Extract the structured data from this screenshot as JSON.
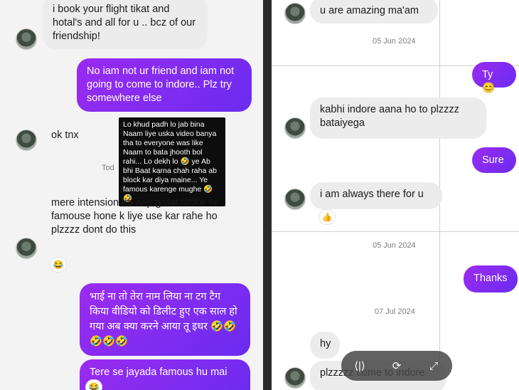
{
  "left": {
    "messages": [
      {
        "id": "m1",
        "text": "i book your flight tikat and hotal's and all for u .. bcz of our friendship!"
      },
      {
        "id": "m2",
        "text": "No iam not ur friend and iam not going to come to indore.. Plz try somewhere else"
      },
      {
        "id": "m3",
        "text": "ok tnx"
      },
      {
        "id": "m4",
        "text": "Tod"
      },
      {
        "id": "m5",
        "text": "mere intension ko aap galat tatike se famouse hone k liye use kar rahe ho plzzzz dont do this"
      },
      {
        "id": "m5r",
        "text": "😂"
      },
      {
        "id": "m6",
        "text": "भाई ना तो तेरा नाम लिया ना टग टैग किया वीडियो को डिलीट हुए एक साल हो गया अब क्या करने आया तू इधर 🤣🤣🤣🤣🤣"
      },
      {
        "id": "m7",
        "text": "Tere se jayada famous hu mai"
      },
      {
        "id": "m7r",
        "text": "😂"
      }
    ],
    "overlay": "Lo khud padh lo jab bina Naam liye uska video banya tha to everyone was like Naam to bata jhooth bol rahi... Lo dekh lo 🤣 ye Ab bhi Baat karna chah raha ab block kar diya maine... Ye famous karenge mughe 🤣🤣"
  },
  "right": {
    "messages": [
      {
        "id": "r1",
        "text": "u are amazing ma'am"
      },
      {
        "id": "r2",
        "text": "Ty 😊"
      },
      {
        "id": "r3",
        "text": "kabhi indore aana ho to plzzzz bataiyega"
      },
      {
        "id": "r4",
        "text": "Sure"
      },
      {
        "id": "r5",
        "text": "i am always there for u"
      },
      {
        "id": "r5r",
        "text": "👍"
      },
      {
        "id": "r6",
        "text": "Thanks"
      },
      {
        "id": "r7",
        "text": "hy"
      },
      {
        "id": "r8",
        "text": "plzzzzz come to indore"
      }
    ],
    "dates": [
      "05 Jun 2024",
      "05 Jun 2024",
      "07 Jul 2024"
    ]
  },
  "toolbar": {
    "items": [
      {
        "icon": "split-view-icon",
        "glyph": "⟨|⟩"
      },
      {
        "icon": "rotate-icon",
        "glyph": "⟳"
      },
      {
        "icon": "expand-icon",
        "glyph": "⤢"
      }
    ]
  },
  "colors": {
    "outgoing_start": "#9b2bf0",
    "outgoing_end": "#6a2cf0",
    "incoming": "#ececec"
  }
}
